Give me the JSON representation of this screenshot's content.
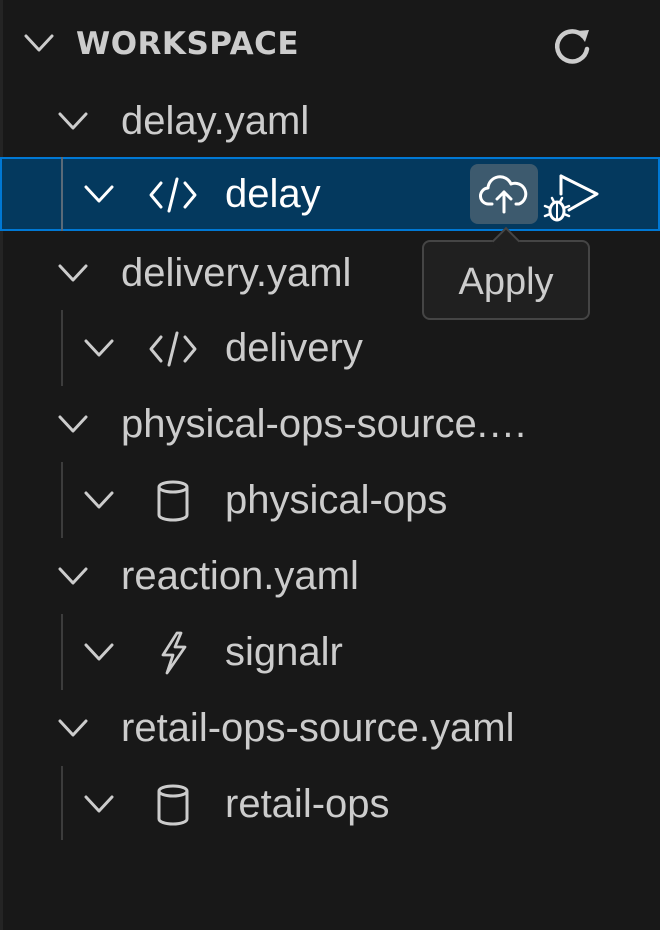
{
  "section": {
    "title": "WORKSPACE"
  },
  "tree": {
    "files": [
      {
        "name": "delay.yaml",
        "child": {
          "label": "delay",
          "kind": "code-icon",
          "selected": true
        }
      },
      {
        "name": "delivery.yaml",
        "child": {
          "label": "delivery",
          "kind": "code-icon"
        }
      },
      {
        "name": "physical-ops-source.yaml",
        "display": "physical-ops-source.…",
        "child": {
          "label": "physical-ops",
          "kind": "database-icon"
        }
      },
      {
        "name": "reaction.yaml",
        "child": {
          "label": "signalr",
          "kind": "lightning-icon"
        }
      },
      {
        "name": "retail-ops-source.yaml",
        "child": {
          "label": "retail-ops",
          "kind": "database-icon"
        }
      }
    ]
  },
  "tooltip": {
    "text": "Apply"
  },
  "icons": {
    "refresh": "refresh-icon",
    "apply": "cloud-upload-icon",
    "debug": "debug-run-icon"
  },
  "colors": {
    "background": "#181818",
    "selection_bg": "#04395e",
    "selection_border": "#0078d4",
    "text": "#cccccc",
    "selected_text": "#ffffff"
  }
}
